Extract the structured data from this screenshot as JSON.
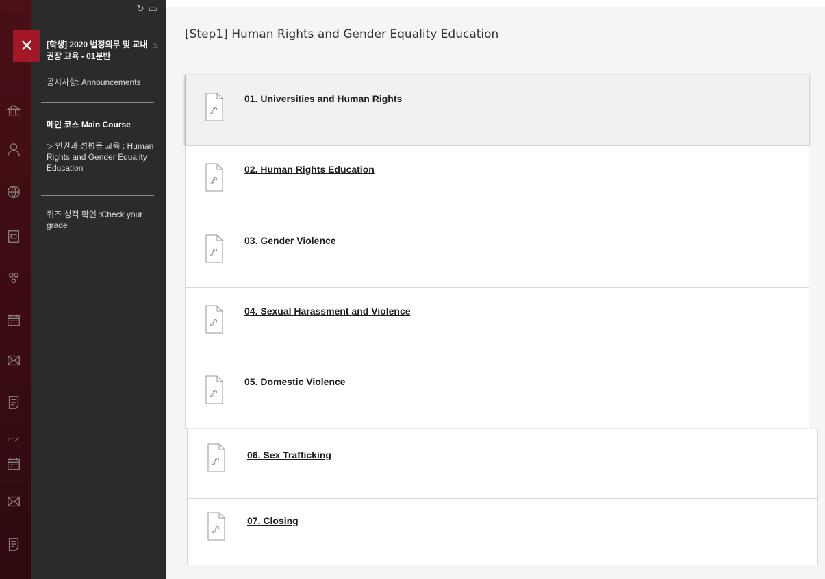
{
  "sidebar": {
    "course_title": "[학생] 2020 법정의무 및 교내권장 교육 - 01분반",
    "items": [
      {
        "label": "공지사항: Announcements"
      },
      {
        "label": "메인 코스 Main Course"
      },
      {
        "label": "▷ 인권과 성평등 교육 : Human Rights and Gender Equality Education"
      },
      {
        "label": "퀴즈 성적 확인 :Check your grade"
      }
    ]
  },
  "main": {
    "title": "[Step1] Human Rights and Gender Equality Education",
    "items": [
      {
        "label": "01. Universities and Human Rights"
      },
      {
        "label": "02. Human Rights Education"
      },
      {
        "label": "03. Gender Violence"
      },
      {
        "label": "04. Sexual Harassment and Violence"
      },
      {
        "label": "05. Domestic Violence"
      },
      {
        "label": "06. Sex Trafficking"
      },
      {
        "label": "07. Closing"
      }
    ]
  },
  "colors": {
    "rail": "#3a0d12",
    "close_button": "#a31826",
    "menu_panel": "#2c2b2b",
    "content_bg": "#f5f5f5"
  }
}
